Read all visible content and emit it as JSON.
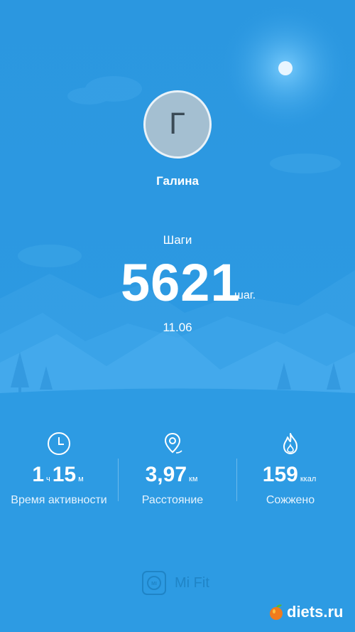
{
  "profile": {
    "avatar_letter": "Г",
    "name": "Галина"
  },
  "steps": {
    "label": "Шаги",
    "value": "5621",
    "unit": "шаг.",
    "date": "11.06"
  },
  "stats": {
    "activity": {
      "hours": "1",
      "hours_unit": "ч",
      "minutes": "15",
      "minutes_unit": "м",
      "label": "Время активности",
      "icon": "clock-icon"
    },
    "distance": {
      "value": "3,97",
      "unit": "км",
      "label": "Расстояние",
      "icon": "location-pin-icon"
    },
    "calories": {
      "value": "159",
      "unit": "ккал",
      "label": "Сожжено",
      "icon": "flame-icon"
    }
  },
  "brand": {
    "name": "Mi Fit",
    "logo_text": "MI"
  },
  "watermark": {
    "text": "diets.ru"
  },
  "colors": {
    "background": "#2d9be3",
    "brand": "#1f84c6",
    "text": "#ffffff"
  }
}
